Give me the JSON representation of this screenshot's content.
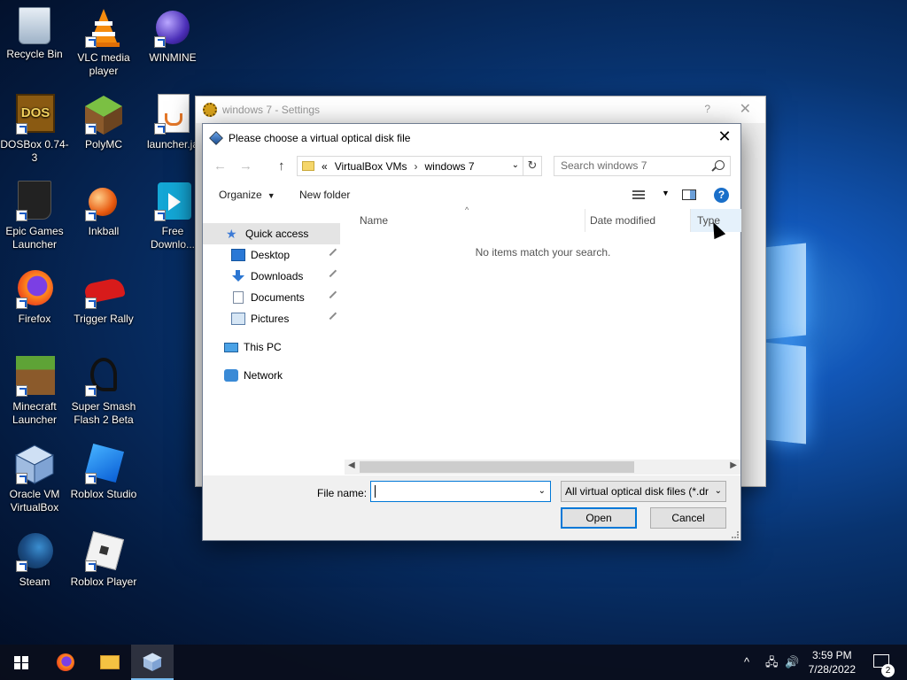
{
  "desktop": {
    "icons": [
      {
        "label": "Recycle Bin"
      },
      {
        "label": "VLC media player"
      },
      {
        "label": "WINMINE"
      },
      {
        "label": "DOSBox 0.74-3"
      },
      {
        "label": "PolyMC"
      },
      {
        "label": "launcher.ja"
      },
      {
        "label": "Epic Games Launcher"
      },
      {
        "label": "Inkball"
      },
      {
        "label": "Free Downlo..."
      },
      {
        "label": "Firefox"
      },
      {
        "label": "Trigger Rally"
      },
      {
        "label": "Minecraft Launcher"
      },
      {
        "label": "Super Smash Flash 2 Beta"
      },
      {
        "label": "Oracle VM VirtualBox"
      },
      {
        "label": "Roblox Studio"
      },
      {
        "label": "Steam"
      },
      {
        "label": "Roblox Player"
      }
    ],
    "dosbox_logo": "DOS"
  },
  "settings_window": {
    "title": "windows 7 - Settings",
    "help": "?",
    "close": "✕"
  },
  "dialog": {
    "title": "Please choose a virtual optical disk file",
    "close": "✕",
    "nav": {
      "back": "←",
      "forward": "→",
      "up": "↑"
    },
    "address": {
      "prefix": "«",
      "segments": [
        "VirtualBox VMs",
        "windows 7"
      ],
      "dropdown": "⌄",
      "refresh": "↻"
    },
    "search": {
      "placeholder": "Search windows 7"
    },
    "toolbar": {
      "organize": "Organize",
      "new_folder": "New folder",
      "help": "?"
    },
    "nav_pane": [
      {
        "label": "Quick access",
        "icon": "star-icon",
        "selected": true
      },
      {
        "label": "Desktop",
        "icon": "desktop-folder-icon",
        "pinned": true
      },
      {
        "label": "Downloads",
        "icon": "download-icon",
        "pinned": true
      },
      {
        "label": "Documents",
        "icon": "document-icon",
        "pinned": true
      },
      {
        "label": "Pictures",
        "icon": "pictures-icon",
        "pinned": true
      },
      {
        "label": "This PC",
        "icon": "computer-icon"
      },
      {
        "label": "Network",
        "icon": "network-icon"
      }
    ],
    "columns": {
      "name": "Name",
      "date_modified": "Date modified",
      "type": "Type"
    },
    "empty_message": "No items match your search.",
    "file_name_label": "File name:",
    "file_name_value": "",
    "filter": "All virtual optical disk files (*.dr",
    "open_button": "Open",
    "cancel_button": "Cancel"
  },
  "taskbar": {
    "time": "3:59 PM",
    "date": "7/28/2022",
    "notification_count": "2",
    "tray_chevron": "^"
  }
}
